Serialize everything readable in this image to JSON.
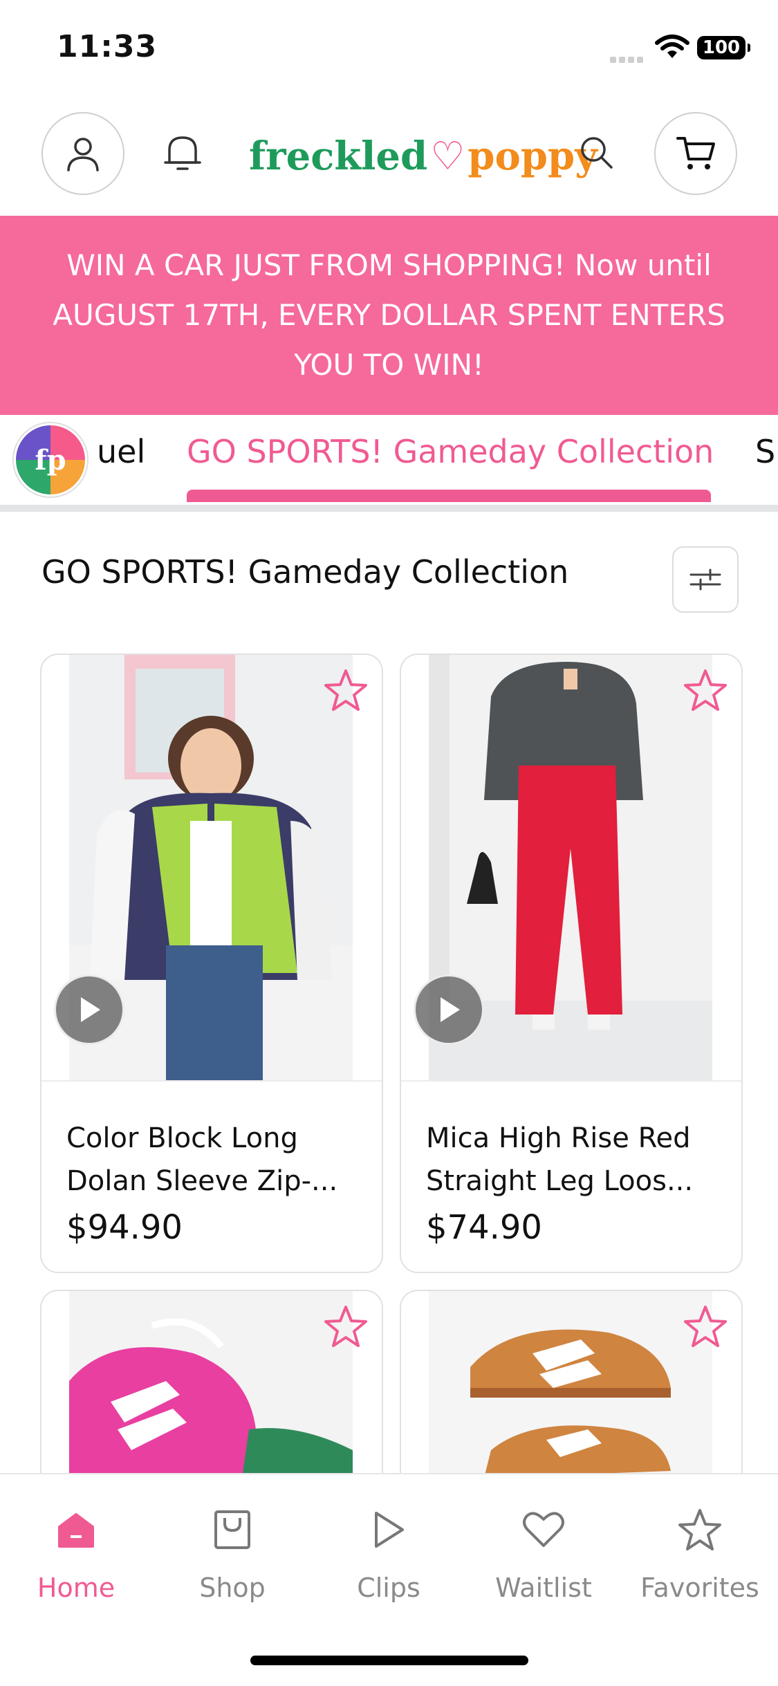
{
  "status_bar": {
    "time": "11:33",
    "battery": "100"
  },
  "header": {
    "logo": {
      "part1": "freckled",
      "part2": "poppy"
    }
  },
  "promo": {
    "text": "WIN A CAR JUST FROM SHOPPING! Now until AUGUST 17TH, EVERY DOLLAR SPENT ENTERS YOU TO WIN!"
  },
  "tabs": {
    "badge": "fp",
    "prev": "uel",
    "active": "GO SPORTS! Gameday Collection",
    "next": "S"
  },
  "section": {
    "title": "GO SPORTS! Gameday Collection"
  },
  "products": [
    {
      "name": "Color Block Long Dolan Sleeve Zip-...",
      "price": "$94.90",
      "has_video": true
    },
    {
      "name": "Mica High Rise Red Straight Leg Loos...",
      "price": "$74.90",
      "has_video": true
    },
    {
      "name": "",
      "price": "",
      "has_video": false
    },
    {
      "name": "",
      "price": "",
      "has_video": false
    }
  ],
  "nav": [
    {
      "label": "Home",
      "icon": "home-icon",
      "active": true
    },
    {
      "label": "Shop",
      "icon": "shopping-bag-icon",
      "active": false
    },
    {
      "label": "Clips",
      "icon": "play-icon",
      "active": false
    },
    {
      "label": "Waitlist",
      "icon": "heart-icon",
      "active": false
    },
    {
      "label": "Favorites",
      "icon": "star-icon",
      "active": false
    }
  ],
  "colors": {
    "accent": "#f05a93",
    "promo_bg": "#f6699b"
  }
}
